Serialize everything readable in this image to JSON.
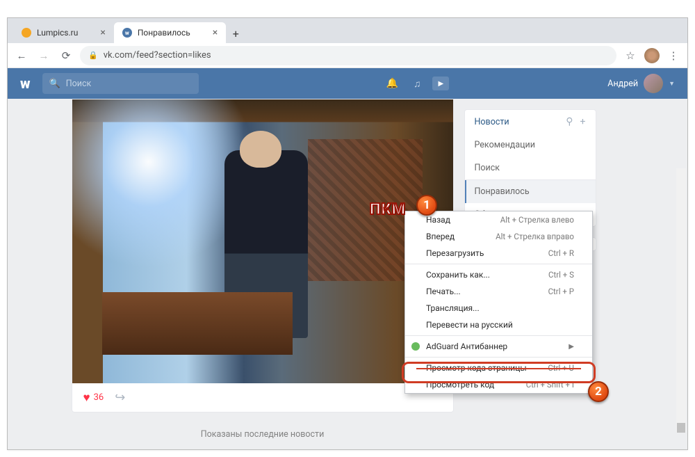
{
  "window": {
    "tabs": [
      {
        "title": "Lumpics.ru"
      },
      {
        "title": "Понравилось"
      }
    ],
    "url": "vk.com/feed?section=likes"
  },
  "vk": {
    "search_placeholder": "Поиск",
    "username": "Андрей"
  },
  "post": {
    "likes": "36"
  },
  "sidebar": {
    "items": [
      {
        "label": "Новости"
      },
      {
        "label": "Рекомендации"
      },
      {
        "label": "Поиск"
      },
      {
        "label": "Понравилось"
      },
      {
        "label": "Обновления"
      }
    ]
  },
  "status": "Показаны последние новости",
  "annotation": {
    "pkm": "ПКМ",
    "badge1": "1",
    "badge2": "2"
  },
  "context_menu": {
    "items": [
      {
        "label": "Назад",
        "shortcut": "Alt + Стрелка влево"
      },
      {
        "label": "Вперед",
        "shortcut": "Alt + Стрелка вправо"
      },
      {
        "label": "Перезагрузить",
        "shortcut": "Ctrl + R"
      },
      {
        "label": "Сохранить как...",
        "shortcut": "Ctrl + S"
      },
      {
        "label": "Печать...",
        "shortcut": "Ctrl + P"
      },
      {
        "label": "Трансляция..."
      },
      {
        "label": "Перевести на русский"
      },
      {
        "label": "AdGuard Антибаннер"
      },
      {
        "label": "Просмотр кода страницы",
        "shortcut": "Ctrl + U"
      },
      {
        "label": "Просмотреть код",
        "shortcut": "Ctrl + Shift + I"
      }
    ]
  }
}
